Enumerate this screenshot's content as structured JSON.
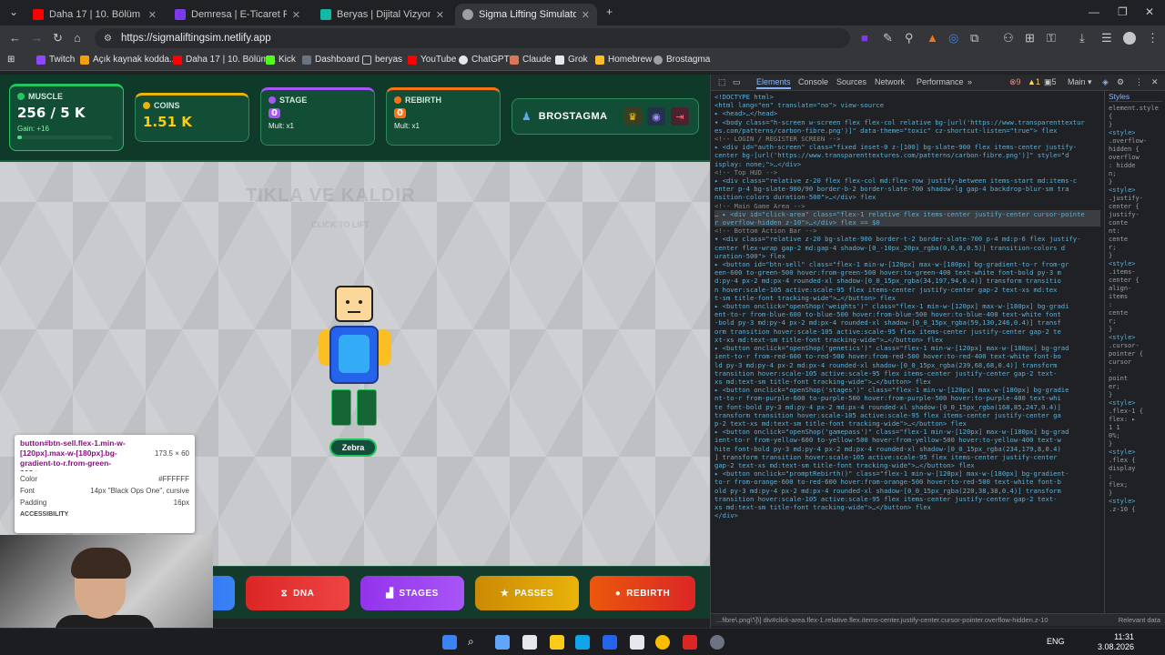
{
  "browser": {
    "tabs": [
      {
        "title": "Daha 17 | 10. Bölüm - YouTube",
        "color": "#ff0000"
      },
      {
        "title": "Demresa | E-Ticaret Paketleri &",
        "color": "#7c3aed"
      },
      {
        "title": "Beryas | Dijital Vizyonunuzu Ge",
        "color": "#14b8a6"
      },
      {
        "title": "Sigma Lifting Simulator",
        "color": "#9aa0a6"
      }
    ],
    "url": "https://sigmaliftingsim.netlify.app",
    "bookmarks": [
      {
        "label": "Twitch",
        "color": "#9146ff"
      },
      {
        "label": "Açık kaynak kodda...",
        "color": "#f59e0b"
      },
      {
        "label": "Daha 17 | 10. Bölüm...",
        "color": "#ff0000"
      },
      {
        "label": "Kick",
        "color": "#53fc18"
      },
      {
        "label": "Dashboard",
        "color": "#6b7280"
      },
      {
        "label": "beryas",
        "color": "#9aa0a6"
      },
      {
        "label": "YouTube",
        "color": "#ff0000"
      },
      {
        "label": "ChatGPT",
        "color": "#e5e7eb"
      },
      {
        "label": "Claude",
        "color": "#d97757"
      },
      {
        "label": "Grok",
        "color": "#e5e7eb"
      },
      {
        "label": "Homebrew",
        "color": "#fbbf24"
      },
      {
        "label": "Brostagma",
        "color": "#9aa0a6"
      }
    ]
  },
  "hud": {
    "muscle": {
      "label": "MUSCLE",
      "value": "256 / 5 K",
      "gain": "Gain: +16",
      "progress": 0.05
    },
    "coins": {
      "label": "COINS",
      "value": "1.51 K"
    },
    "stage": {
      "label": "STAGE",
      "value": "0",
      "mult": "Mult: x1"
    },
    "rebirth": {
      "label": "REBIRTH",
      "value": "0",
      "mult": "Mult: x1"
    },
    "profile": {
      "name": "BROSTAGMA"
    }
  },
  "game": {
    "watermark": "TIKLA VE KALDIR",
    "watermark_sub": "CLICK TO LIFT",
    "character_name": "Zebra"
  },
  "actions": [
    {
      "label": "DNA",
      "icon": "⧖",
      "color": "#ef4444"
    },
    {
      "label": "STAGES",
      "icon": "▟",
      "color": "#a855f7"
    },
    {
      "label": "PASSES",
      "icon": "★",
      "color": "#eab308"
    },
    {
      "label": "REBIRTH",
      "icon": "●",
      "color": "#f97316"
    }
  ],
  "tooltip": {
    "selector": "button#btn-sell.flex-1.min-w-[120px].max-w-[180px].bg-gradient-to-r.from-green-600.to...",
    "size": "173.5 × 60",
    "color_label": "Color",
    "color_value": "#FFFFFF",
    "font_label": "Font",
    "font_value": "14px \"Black Ops One\", cursive",
    "padding_label": "Padding",
    "padding_value": "16px",
    "accessibility": "ACCESSIBILITY"
  },
  "devtools": {
    "tabs": [
      "Elements",
      "Console",
      "Sources",
      "Network",
      "Performance"
    ],
    "errors": "9",
    "warnings": "1",
    "info": "5",
    "context": "Main",
    "styles_tab": "Styles",
    "breadcrumb": "...fibre\\.png\\'\\]\\]   div#click-area.flex-1.relative.flex.items-center.justify-center.cursor-pointer.overflow-hidden.z-10",
    "relevant": "Relevant data",
    "lines": [
      "<!DOCTYPE html>",
      "<html lang=\"en\" translate=\"no\"> view-source",
      " ▸ <head>…</head>",
      " ▾ <body class=\"h-screen w-screen flex flex-col relative bg-[url('https://www.transparenttextur",
      "   es.com/patterns/carbon-fibre.png')]\" data-theme=\"toxic\" cz-shortcut-listen=\"true\"> flex",
      "     <!-- LOGIN / REGISTER SCREEN -->",
      "   ▸ <div id=\"auth-screen\" class=\"fixed inset-0 z-[100] bg-slate-900 flex items-center justify-",
      "     center bg-[url('https://www.transparenttextures.com/patterns/carbon-fibre.png')]\" style=\"d",
      "     isplay: none;\">…</div>",
      "     <!-- Top HUD -->",
      "   ▸ <div class=\"relative z-20 flex flex-col md:flex-row justify-between items-start md:items-c",
      "     enter p-4 bg-slate-900/90 border-b-2 border-slate-700 shadow-lg gap-4 backdrop-blur-sm tra",
      "     nsition-colors duration-500\">…</div> flex",
      "     <!-- Main Game Area -->",
      " … ▸ <div id=\"click-area\" class=\"flex-1 relative flex items-center justify-center cursor-pointe",
      "     r overflow-hidden z-10\">…</div> flex == $0",
      "     <!-- Bottom Action Bar -->",
      "   ▾ <div class=\"relative z-20 bg-slate-900 border-t-2 border-slate-700 p-4 md:p-6 flex justify-",
      "     center flex-wrap gap-2 md:gap-4 shadow-[0_-10px_20px_rgba(0,0,0,0.5)] transition-colors d",
      "     uration-500\"> flex",
      "     ▸ <button id=\"btn-sell\" class=\"flex-1 min-w-[120px] max-w-[180px] bg-gradient-to-r from-gr",
      "       een-600 to-green-500 hover:from-green-500 hover:to-green-400 text-white font-bold py-3 m",
      "       d:py-4 px-2 md:px-4 rounded-xl shadow-[0_0_15px_rgba(34,197,94,0.4)] transform transitio",
      "       n hover:scale-105 active:scale-95 flex items-center justify-center gap-2 text-xs md:tex",
      "       t-sm title-font tracking-wide\">…</button> flex",
      "     ▸ <button onclick=\"openShop('weights')\" class=\"flex-1 min-w-[120px] max-w-[180px] bg-gradi",
      "       ent-to-r from-blue-600 to-blue-500 hover:from-blue-500 hover:to-blue-400 text-white font",
      "       -bold py-3 md:py-4 px-2 md:px-4 rounded-xl shadow-[0_0_15px_rgba(59,130,246,0.4)] transf",
      "       orm transition hover:scale-105 active:scale-95 flex items-center justify-center gap-2 te",
      "       xt-xs md:text-sm title-font tracking-wide\">…</button> flex",
      "     ▸ <button onclick=\"openShop('genetics')\" class=\"flex-1 min-w-[120px] max-w-[180px] bg-grad",
      "       ient-to-r from-red-600 to-red-500 hover:from-red-500 hover:to-red-400 text-white font-bo",
      "       ld py-3 md:py-4 px-2 md:px-4 rounded-xl shadow-[0_0_15px_rgba(239,68,68,0.4)] transform",
      "       transition hover:scale-105 active:scale-95 flex items-center justify-center gap-2 text-",
      "       xs md:text-sm title-font tracking-wide\">…</button> flex",
      "     ▸ <button onclick=\"openShop('stages')\" class=\"flex-1 min-w-[120px] max-w-[180px] bg-gradie",
      "       nt-to-r from-purple-600 to-purple-500 hover:from-purple-500 hover:to-purple-400 text-whi",
      "       te font-bold py-3 md:py-4 px-2 md:px-4 rounded-xl shadow-[0_0_15px_rgba(168,85,247,0.4)]",
      "       transform transition hover:scale-105 active:scale-95 flex items-center justify-center ga",
      "       p-2 text-xs md:text-sm title-font tracking-wide\">…</button> flex",
      "     ▸ <button onclick=\"openShop('gamepass')\" class=\"flex-1 min-w-[120px] max-w-[180px] bg-grad",
      "       ient-to-r from-yellow-600 to-yellow-500 hover:from-yellow-500 hover:to-yellow-400 text-w",
      "       hite font-bold py-3 md:py-4 px-2 md:px-4 rounded-xl shadow-[0_0_15px_rgba(234,179,8,0.4)",
      "       ] transform transition hover:scale-105 active:scale-95 flex items-center justify-center",
      "       gap-2 text-xs md:text-sm title-font tracking-wide\">…</button> flex",
      "     ▸ <button onclick=\"promptRebirth()\" class=\"flex-1 min-w-[120px] max-w-[180px] bg-gradient-",
      "       to-r from-orange-600 to-red-600 hover:from-orange-500 hover:to-red-500 text-white font-b",
      "       old py-3 md:py-4 px-2 md:px-4 rounded-xl shadow-[0_0_15px_rgba(220,38,38,0.4)] transform",
      "       transition hover:scale-105 active:scale-95 flex items-center justify-center gap-2 text-",
      "       xs md:text-sm title-font tracking-wide\">…</button> flex",
      "     </div>"
    ],
    "styles_lines": [
      "element.style {",
      "}",
      "<style>",
      ".overflow-",
      "hidden {",
      "  overflow",
      ": hidde",
      "n;",
      "}",
      "<style>",
      ".justify-",
      "center {",
      "  justify-",
      "  conte",
      "  nt:",
      "  cente",
      "  r;",
      "}",
      "<style>",
      ".items-",
      "center {",
      "  align-",
      "  items",
      ":",
      "  cente",
      "  r;",
      "}",
      "<style>",
      ".cursor-",
      "pointer {",
      "  cursor",
      ":",
      "  point",
      "  er;",
      "}",
      "<style>",
      ".flex-1 {",
      "  flex: ▸",
      "  1 1",
      "  0%;",
      "}",
      "<style>",
      ".flex {",
      "  display",
      ":",
      "  flex;",
      "}",
      "<style>",
      ".z-10 {"
    ]
  },
  "taskbar": {
    "lang": "ENG",
    "time": "11:31",
    "date": "3.08.2026"
  }
}
